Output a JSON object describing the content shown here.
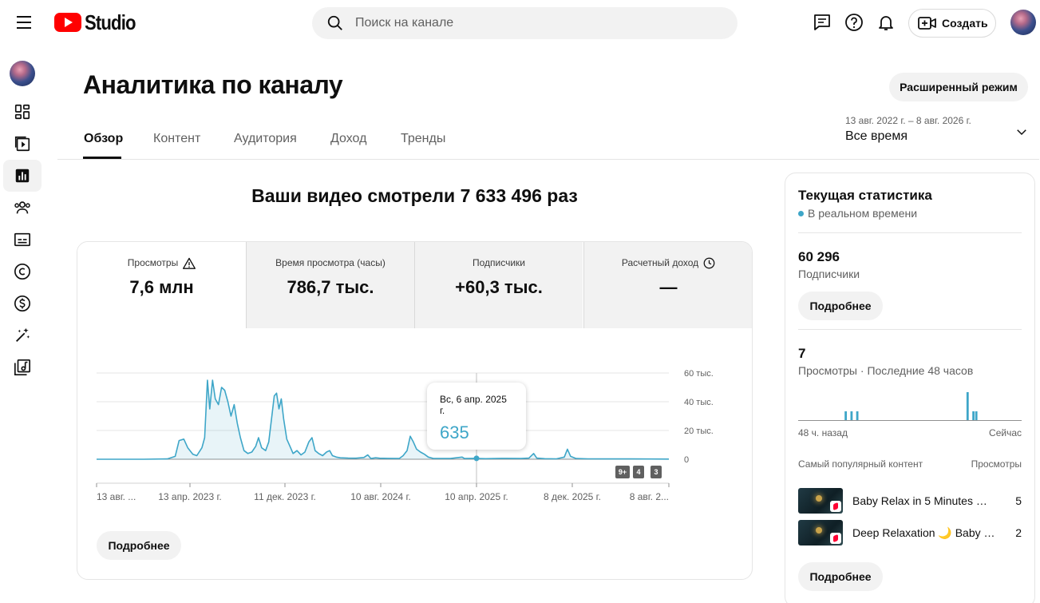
{
  "app": {
    "logo_text": "Studio"
  },
  "header": {
    "search_placeholder": "Поиск на канале",
    "create_label": "Создать"
  },
  "page": {
    "title": "Аналитика по каналу",
    "advanced_mode_label": "Расширенный режим",
    "tabs": [
      {
        "label": "Обзор",
        "active": true
      },
      {
        "label": "Контент",
        "active": false
      },
      {
        "label": "Аудитория",
        "active": false
      },
      {
        "label": "Доход",
        "active": false
      },
      {
        "label": "Тренды",
        "active": false
      }
    ],
    "date_range": {
      "dates": "13 авг. 2022 г. – 8 авг. 2026 г.",
      "label": "Все время"
    }
  },
  "overview": {
    "headline": "Ваши видео смотрели 7 633 496 раз",
    "metrics": [
      {
        "label": "Просмотры",
        "value": "7,6 млн",
        "icon": "warning-icon"
      },
      {
        "label": "Время просмотра (часы)",
        "value": "786,7 тыс."
      },
      {
        "label": "Подписчики",
        "value": "+60,3 тыс."
      },
      {
        "label": "Расчетный доход",
        "value": "—",
        "icon": "clock-icon"
      }
    ],
    "tooltip": {
      "date": "Вс, 6 апр. 2025 г.",
      "value": "635"
    },
    "badges": [
      "9+",
      "4",
      "3"
    ],
    "more_label": "Подробнее"
  },
  "chart_data": {
    "type": "line",
    "series": [
      {
        "name": "Просмотры",
        "color": "#3ea6c8"
      }
    ],
    "x_ticks": [
      "13 авг. ...",
      "13 апр. 2023 г.",
      "11 дек. 2023 г.",
      "10 авг. 2024 г.",
      "10 апр. 2025 г.",
      "8 дек. 2025 г.",
      "8 авг. 2..."
    ],
    "y_ticks": [
      "60 тыс.",
      "40 тыс.",
      "20 тыс.",
      "0"
    ],
    "ylim": [
      0,
      60000
    ],
    "x_index_range": [
      0,
      1456
    ],
    "points": [
      [
        0,
        0
      ],
      [
        120,
        0
      ],
      [
        180,
        200
      ],
      [
        200,
        2000
      ],
      [
        210,
        13000
      ],
      [
        222,
        14000
      ],
      [
        232,
        8000
      ],
      [
        245,
        3500
      ],
      [
        255,
        2500
      ],
      [
        268,
        8000
      ],
      [
        275,
        15000
      ],
      [
        282,
        55000
      ],
      [
        288,
        35000
      ],
      [
        295,
        55000
      ],
      [
        302,
        42000
      ],
      [
        310,
        38000
      ],
      [
        318,
        50000
      ],
      [
        326,
        48000
      ],
      [
        334,
        40000
      ],
      [
        342,
        30000
      ],
      [
        350,
        38000
      ],
      [
        358,
        25000
      ],
      [
        366,
        15000
      ],
      [
        375,
        6000
      ],
      [
        385,
        4000
      ],
      [
        395,
        5000
      ],
      [
        405,
        9000
      ],
      [
        412,
        15000
      ],
      [
        420,
        8000
      ],
      [
        430,
        6000
      ],
      [
        438,
        12000
      ],
      [
        446,
        30000
      ],
      [
        452,
        44000
      ],
      [
        458,
        46000
      ],
      [
        464,
        35000
      ],
      [
        470,
        42000
      ],
      [
        476,
        28000
      ],
      [
        484,
        14000
      ],
      [
        492,
        9000
      ],
      [
        500,
        4000
      ],
      [
        510,
        6000
      ],
      [
        520,
        3000
      ],
      [
        530,
        5000
      ],
      [
        540,
        12000
      ],
      [
        548,
        15000
      ],
      [
        556,
        6000
      ],
      [
        565,
        4000
      ],
      [
        575,
        2500
      ],
      [
        585,
        5000
      ],
      [
        593,
        6000
      ],
      [
        600,
        2500
      ],
      [
        610,
        1500
      ],
      [
        620,
        1000
      ],
      [
        640,
        800
      ],
      [
        660,
        700
      ],
      [
        680,
        1200
      ],
      [
        690,
        3000
      ],
      [
        698,
        500
      ],
      [
        710,
        1000
      ],
      [
        720,
        700
      ],
      [
        740,
        600
      ],
      [
        770,
        500
      ],
      [
        780,
        2500
      ],
      [
        790,
        6000
      ],
      [
        798,
        16000
      ],
      [
        806,
        12000
      ],
      [
        814,
        7000
      ],
      [
        824,
        5000
      ],
      [
        834,
        3500
      ],
      [
        844,
        1500
      ],
      [
        856,
        600
      ],
      [
        900,
        500
      ],
      [
        930,
        1500
      ],
      [
        936,
        500
      ],
      [
        960,
        635
      ],
      [
        990,
        400
      ],
      [
        1030,
        600
      ],
      [
        1080,
        500
      ],
      [
        1100,
        800
      ],
      [
        1112,
        4000
      ],
      [
        1120,
        800
      ],
      [
        1140,
        400
      ],
      [
        1170,
        300
      ],
      [
        1190,
        1500
      ],
      [
        1198,
        7000
      ],
      [
        1206,
        2000
      ],
      [
        1220,
        500
      ],
      [
        1250,
        300
      ],
      [
        1300,
        250
      ],
      [
        1360,
        200
      ],
      [
        1456,
        100
      ]
    ]
  },
  "realtime": {
    "title": "Текущая статистика",
    "live_label": "В реальном времени",
    "subscribers_value": "60 296",
    "subscribers_label": "Подписчики",
    "more_label": "Подробнее",
    "views_value": "7",
    "views_label": "Просмотры · Последние 48 часов",
    "bars_48h": [
      0,
      0,
      0,
      0,
      0,
      0,
      0,
      0,
      0,
      0,
      0,
      0,
      0,
      0,
      0,
      0,
      1,
      0,
      1,
      0,
      1,
      0,
      0,
      0,
      0,
      0,
      0,
      0,
      0,
      0,
      0,
      0,
      0,
      0,
      0,
      0,
      0,
      0,
      0,
      0,
      0,
      0,
      0,
      0,
      0,
      0,
      0,
      0,
      0,
      0,
      0,
      0,
      0,
      0,
      0,
      0,
      0,
      0,
      3,
      0,
      1,
      1,
      0,
      0,
      0,
      0,
      0,
      0,
      0,
      0,
      0,
      0,
      0,
      0,
      0,
      0,
      0
    ],
    "axis_left": "48 ч. назад",
    "axis_right": "Сейчас",
    "top_content_label": "Самый популярный контент",
    "views_col_label": "Просмотры",
    "top_content": [
      {
        "title": "Baby Relax in 5 Minutes 🌙 …",
        "views": "5"
      },
      {
        "title": "Deep Relaxation 🌙 Baby B…",
        "views": "2"
      }
    ],
    "more_label_2": "Подробнее"
  }
}
